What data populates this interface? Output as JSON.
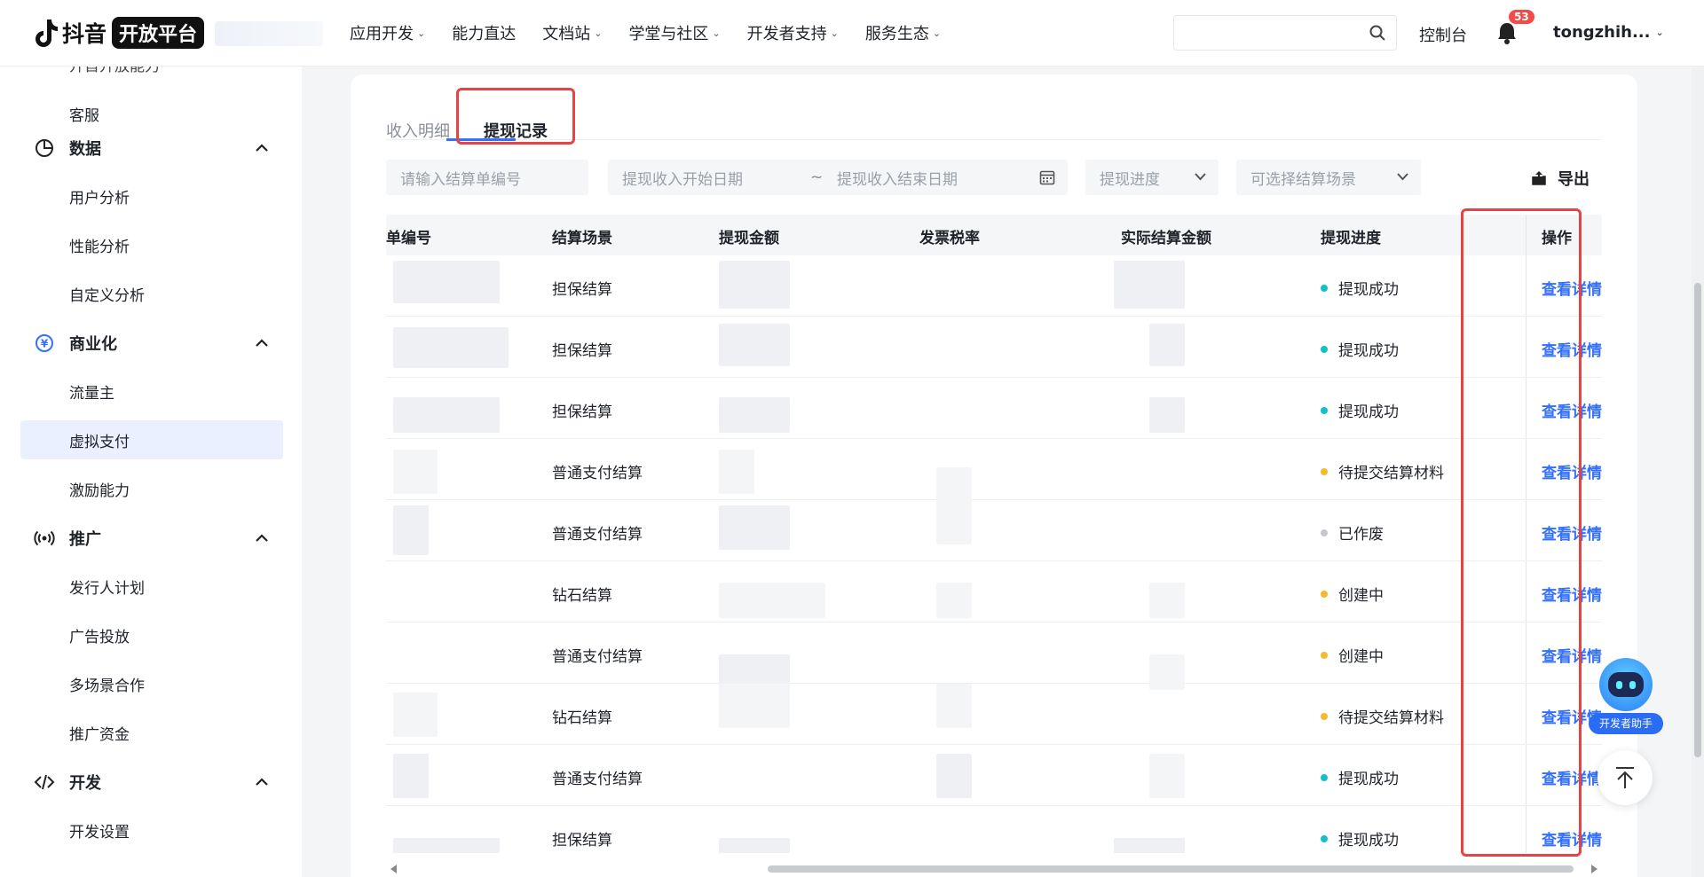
{
  "header": {
    "logo_text": "抖音",
    "logo_badge": "开放平台",
    "nav": [
      {
        "label": "应用开发",
        "chevron": true
      },
      {
        "label": "能力直达",
        "chevron": false
      },
      {
        "label": "文档站",
        "chevron": true
      },
      {
        "label": "学堂与社区",
        "chevron": true
      },
      {
        "label": "开发者支持",
        "chevron": true
      },
      {
        "label": "服务生态",
        "chevron": true
      }
    ],
    "search_placeholder": "",
    "console": "控制台",
    "notification_count": "53",
    "username": "tongzhih..."
  },
  "sidebar": {
    "cut_item": "开首开放能力",
    "groups": [
      {
        "label": "数据",
        "icon": "pie-chart-icon",
        "items": [
          "用户分析",
          "性能分析",
          "自定义分析"
        ]
      },
      {
        "label": "商业化",
        "icon": "yuan-circle-icon",
        "items": [
          "流量主",
          "虚拟支付",
          "激励能力"
        ]
      },
      {
        "label": "推广",
        "icon": "broadcast-icon",
        "items": [
          "发行人计划",
          "广告投放",
          "多场景合作",
          "推广资金"
        ]
      },
      {
        "label": "开发",
        "icon": "code-icon",
        "items": [
          "开发设置"
        ]
      }
    ],
    "top_item": "客服",
    "active_item": "虚拟支付"
  },
  "tabs": [
    "收入明细",
    "提现记录"
  ],
  "active_tab": "提现记录",
  "filters": {
    "order_placeholder": "请输入结算单编号",
    "start_date_placeholder": "提现收入开始日期",
    "date_separator": "~",
    "end_date_placeholder": "提现收入结束日期",
    "progress_placeholder": "提现进度",
    "scene_placeholder": "可选择结算场景",
    "export_label": "导出"
  },
  "table": {
    "columns": [
      "单编号",
      "结算场景",
      "提现金额",
      "发票税率",
      "实际结算金额",
      "提现进度",
      "操作"
    ],
    "rows": [
      {
        "scene": "担保结算",
        "status": "提现成功",
        "status_color": "#14c0c8",
        "action": "查看详情"
      },
      {
        "scene": "担保结算",
        "status": "提现成功",
        "status_color": "#14c0c8",
        "action": "查看详情"
      },
      {
        "scene": "担保结算",
        "status": "提现成功",
        "status_color": "#14c0c8",
        "action": "查看详情"
      },
      {
        "scene": "普通支付结算",
        "status": "待提交结算材料",
        "status_color": "#f5b82e",
        "action": "查看详情"
      },
      {
        "scene": "普通支付结算",
        "status": "已作废",
        "status_color": "#c4c7cc",
        "action": "查看详情"
      },
      {
        "scene": "钻石结算",
        "status": "创建中",
        "status_color": "#f5b82e",
        "action": "查看详情"
      },
      {
        "scene": "普通支付结算",
        "status": "创建中",
        "status_color": "#f5b82e",
        "action": "查看详情"
      },
      {
        "scene": "钻石结算",
        "status": "待提交结算材料",
        "status_color": "#f5b82e",
        "action": "查看详情"
      },
      {
        "scene": "普通支付结算",
        "status": "提现成功",
        "status_color": "#14c0c8",
        "action": "查看详情"
      },
      {
        "scene": "担保结算",
        "status": "提现成功",
        "status_color": "#14c0c8",
        "action": "查看详情"
      }
    ]
  },
  "assistant_label": "开发者助手",
  "colors": {
    "accent": "#3370ff",
    "annotation": "#e84343",
    "success": "#14c0c8",
    "pending": "#f5b82e",
    "void": "#c4c7cc"
  }
}
